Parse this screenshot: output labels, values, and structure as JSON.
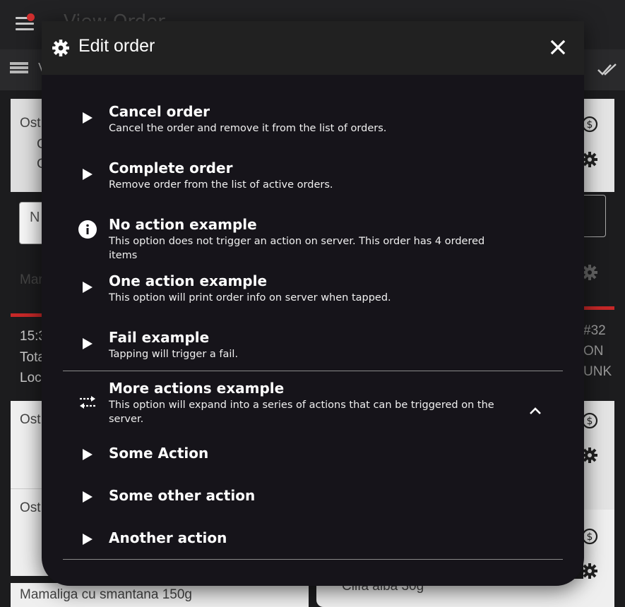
{
  "background": {
    "app_title": "View Order",
    "toolbar_text": "V",
    "card1": {
      "line1": "Ost",
      "line2": "C",
      "line3": "C"
    },
    "field_placeholder": "N",
    "label_mar": "Mar",
    "order_info": {
      "time": "15:3",
      "total": "Tota",
      "location": "Loc"
    },
    "right_info": {
      "number": "#32",
      "status": "ON",
      "label": "UNK"
    },
    "card2_title": "Ost",
    "card3_title": "Ost",
    "bottom_left_item": "Mamaliga cu smantana 150g",
    "bottom_right_item": "Ciifa alba 30g",
    "accent_red": "#c62828"
  },
  "modal": {
    "title": "Edit order",
    "options": [
      {
        "title": "Cancel order",
        "desc": "Cancel the order and remove it from the list of orders.",
        "icon": "play-icon"
      },
      {
        "title": "Complete order",
        "desc": "Remove order from the list of active orders.",
        "icon": "play-icon"
      },
      {
        "title": "No action example",
        "desc": "This option does not trigger an action on server. This order has 4 ordered items",
        "icon": "info-icon"
      },
      {
        "title": "One action example",
        "desc": "This option will print order info on server when tapped.",
        "icon": "play-icon"
      },
      {
        "title": "Fail example",
        "desc": "Tapping will trigger a fail.",
        "icon": "play-icon"
      }
    ],
    "expandable": {
      "title": "More actions example",
      "desc": "This option will expand into a series of actions that can be triggered on the server.",
      "icon": "swap-arrows-icon",
      "expanded": true,
      "sub_actions": [
        {
          "title": "Some Action",
          "icon": "play-icon"
        },
        {
          "title": "Some other action",
          "icon": "play-icon"
        },
        {
          "title": "Another action",
          "icon": "play-icon"
        }
      ]
    }
  }
}
